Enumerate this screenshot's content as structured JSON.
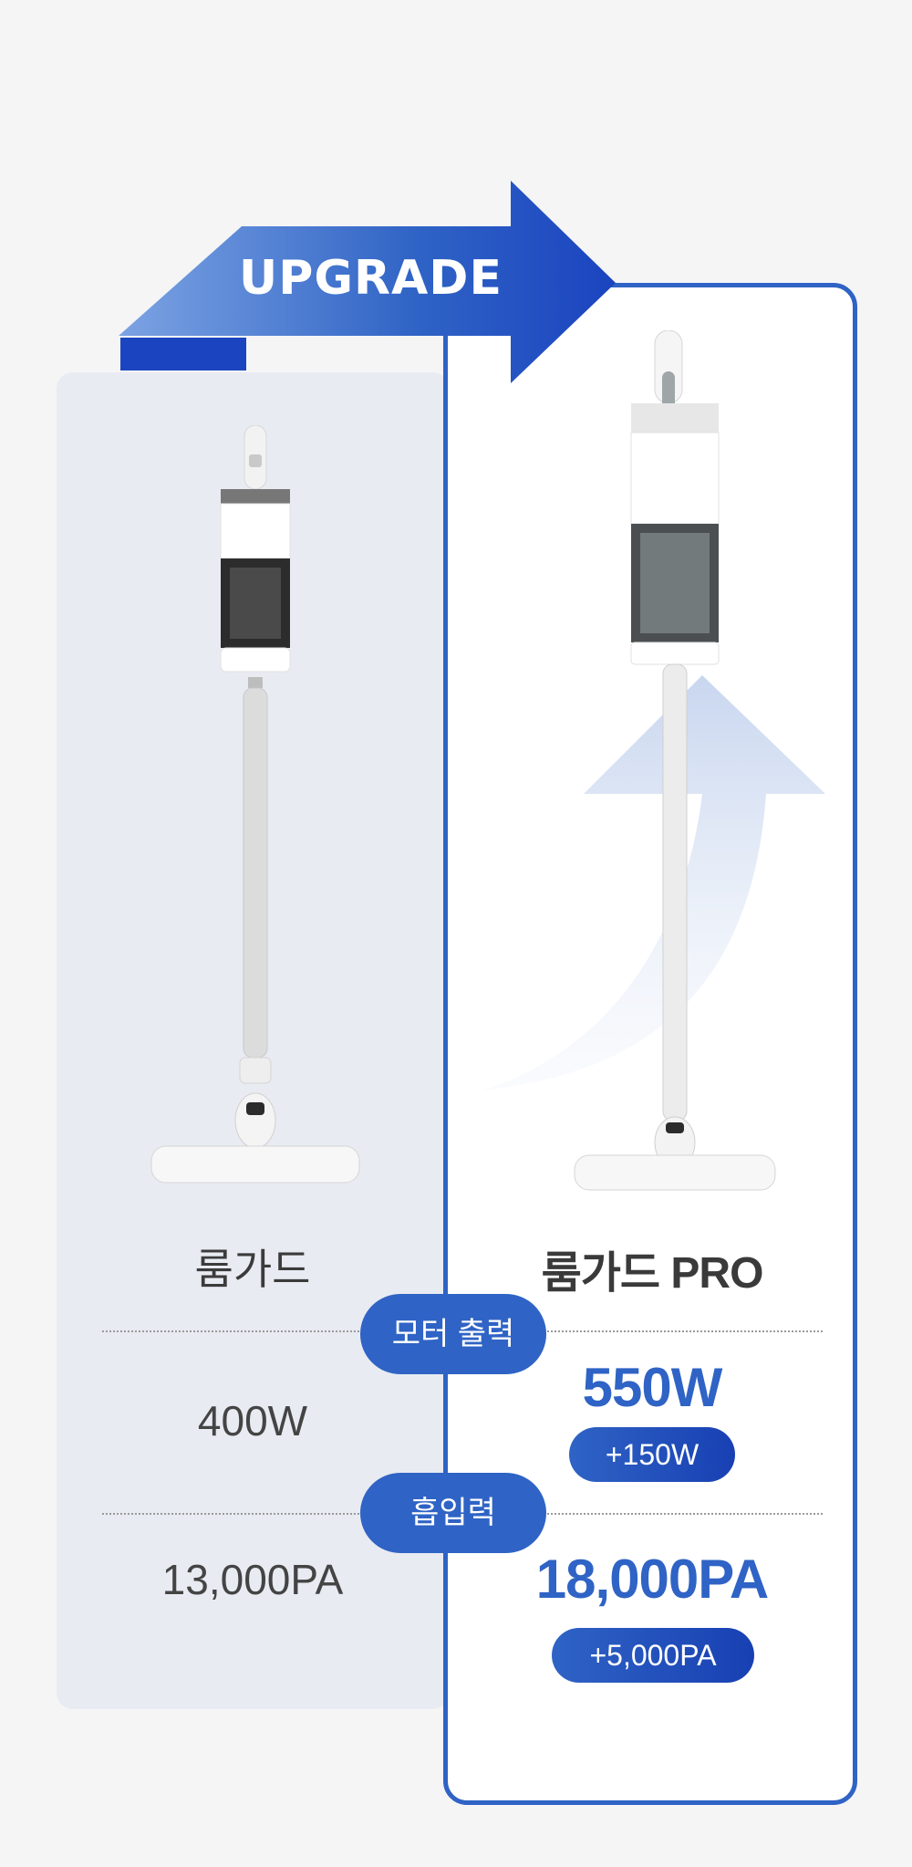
{
  "banner": {
    "label": "UPGRADE"
  },
  "products": {
    "basic": {
      "name": "룸가드"
    },
    "pro": {
      "name": "룸가드 PRO"
    }
  },
  "specs": [
    {
      "label": "모터 출력",
      "basic_value": "400W",
      "pro_value": "550W",
      "diff": "+150W"
    },
    {
      "label": "흡입력",
      "basic_value": "13,000PA",
      "pro_value": "18,000PA",
      "diff": "+5,000PA"
    }
  ],
  "colors": {
    "accent": "#2f63c5",
    "accent_dark": "#1840b3",
    "left_panel": "#e8ebf2",
    "background": "#f5f5f6"
  }
}
